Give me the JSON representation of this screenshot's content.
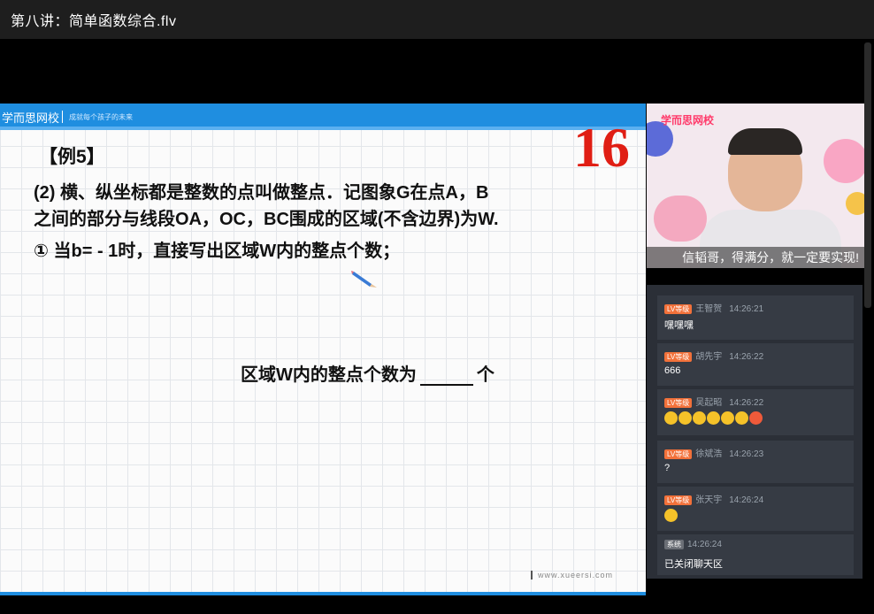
{
  "window": {
    "title": "第八讲：简单函数综合.flv"
  },
  "slide": {
    "brand": "学而思网校",
    "slogan": "成就每个孩子的未来",
    "page_number": "16",
    "example_label": "【例5】",
    "line1": "(2) 横、纵坐标都是整数的点叫做整点．记图象G在点A，B",
    "line2": "之间的部分与线段OA，OC，BC围成的区域(不含边界)为W.",
    "line3": "① 当b= - 1时，直接写出区域W内的整点个数；",
    "answer_prefix": "区域W内的整点个数为",
    "answer_suffix": "个",
    "url": "www.xueersi.com"
  },
  "video": {
    "brand": "学而思网校",
    "caption": "信韬哥，得满分，就一定要实现!"
  },
  "chat": {
    "messages": [
      {
        "badge": "LV等级",
        "name": "王智贺",
        "time": "14:26:21",
        "text": "嘿嘿嘿"
      },
      {
        "badge": "LV等级",
        "name": "胡先宇",
        "time": "14:26:22",
        "text": "666"
      },
      {
        "badge": "LV等级",
        "name": "吴起昭",
        "time": "14:26:22",
        "emojis": [
          "smile",
          "sleepy",
          "angry",
          "fear",
          "sad",
          "surprise",
          "red-angry"
        ]
      },
      {
        "badge": "LV等级",
        "name": "徐斌浩",
        "time": "14:26:23",
        "text": "?"
      },
      {
        "badge": "LV等级",
        "name": "张天宇",
        "time": "14:26:24",
        "emojis": [
          "smile"
        ]
      },
      {
        "badge": "系统",
        "name": "",
        "time": "14:26:24",
        "text": "已关闭聊天区"
      }
    ]
  }
}
